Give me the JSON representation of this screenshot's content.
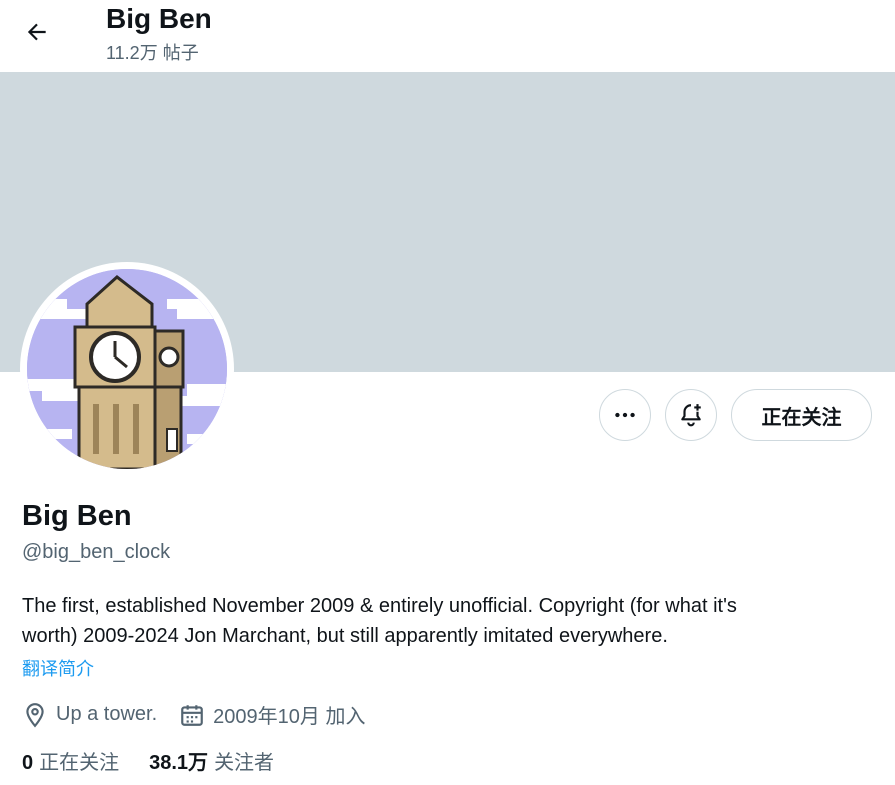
{
  "header": {
    "title": "Big Ben",
    "post_count": "11.2万 帖子"
  },
  "colors": {
    "banner": "#cfd9de",
    "link": "#1d9bf0",
    "secondary_text": "#536471"
  },
  "actions": {
    "more_icon": "more-horizontal-icon",
    "notify_icon": "bell-plus-icon",
    "follow_label": "正在关注"
  },
  "profile": {
    "name": "Big Ben",
    "handle": "@big_ben_clock",
    "bio_line1": "The first, established November 2009 & entirely unofficial. Copyright  (for what it's",
    "bio_line2": "worth) 2009-2024 Jon Marchant, but still apparently imitated everywhere.",
    "translate_label": "翻译简介",
    "location": "Up a tower.",
    "joined": "2009年10月 加入"
  },
  "stats": {
    "following_count": "0",
    "following_label": "正在关注",
    "followers_count": "38.1万",
    "followers_label": "关注者"
  }
}
